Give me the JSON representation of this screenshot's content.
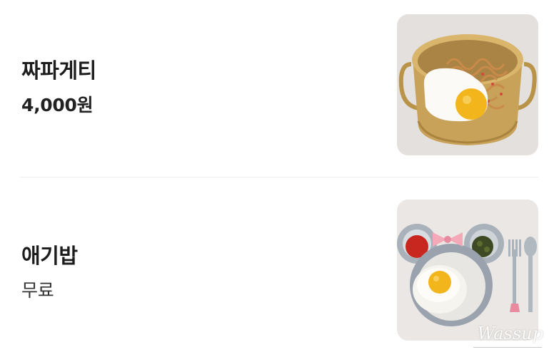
{
  "menu": {
    "items": [
      {
        "name": "짜파게티",
        "price": "4,000원",
        "image_icon": "jjapaghetti-photo"
      },
      {
        "name": "애기밥",
        "price": "무료",
        "image_icon": "kids-meal-photo"
      }
    ]
  },
  "watermark": {
    "text": "Wassup"
  },
  "colors": {
    "pot_gold": "#c9a25a",
    "tray_gray": "#9aa3ad",
    "egg_yolk": "#f2b51c",
    "noodle": "#c98a4a",
    "background": "#ffffff",
    "divider": "#eeeeee"
  }
}
